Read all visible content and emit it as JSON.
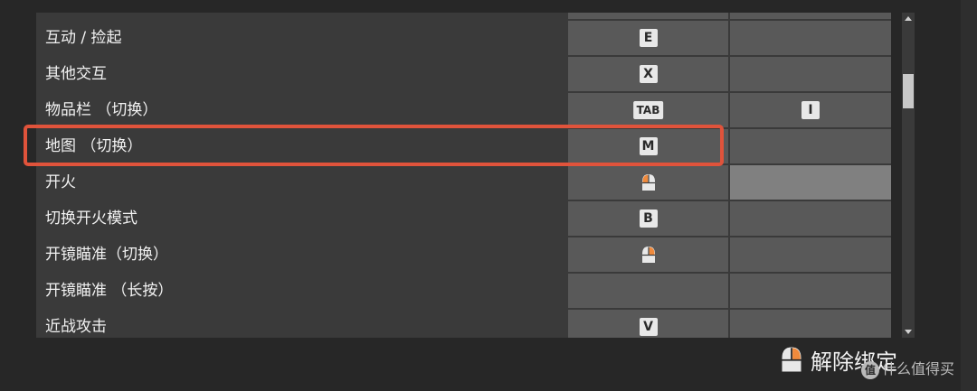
{
  "rows": [
    {
      "action": "互动 / 捡起",
      "primary": "E",
      "secondary": ""
    },
    {
      "action": "其他交互",
      "primary": "X",
      "secondary": ""
    },
    {
      "action": "物品栏 （切换）",
      "primary": "TAB",
      "secondary": "I"
    },
    {
      "action": "地图 （切换）",
      "primary": "M",
      "secondary": ""
    },
    {
      "action": "开火",
      "primary": "mouse-left-click-icon",
      "secondary": ""
    },
    {
      "action": "切换开火模式",
      "primary": "B",
      "secondary": ""
    },
    {
      "action": "开镜瞄准（切换）",
      "primary": "mouse-right-click-icon",
      "secondary": ""
    },
    {
      "action": "开镜瞄准 （长按）",
      "primary": "",
      "secondary": ""
    },
    {
      "action": "近战攻击",
      "primary": "V",
      "secondary": ""
    }
  ],
  "highlighted_row": "地图 （切换）",
  "footer": {
    "unbind_label": "解除绑定",
    "unbind_icon": "mouse-right-click-icon"
  },
  "watermark": {
    "badge": "值",
    "text": "什么值得买"
  },
  "colors": {
    "background": "#272727",
    "panel": "#3a3a3a",
    "cell": "#595959",
    "cell_selected": "#808080",
    "highlight_border": "#e0533b",
    "mouse_accent": "#f08a3c"
  }
}
